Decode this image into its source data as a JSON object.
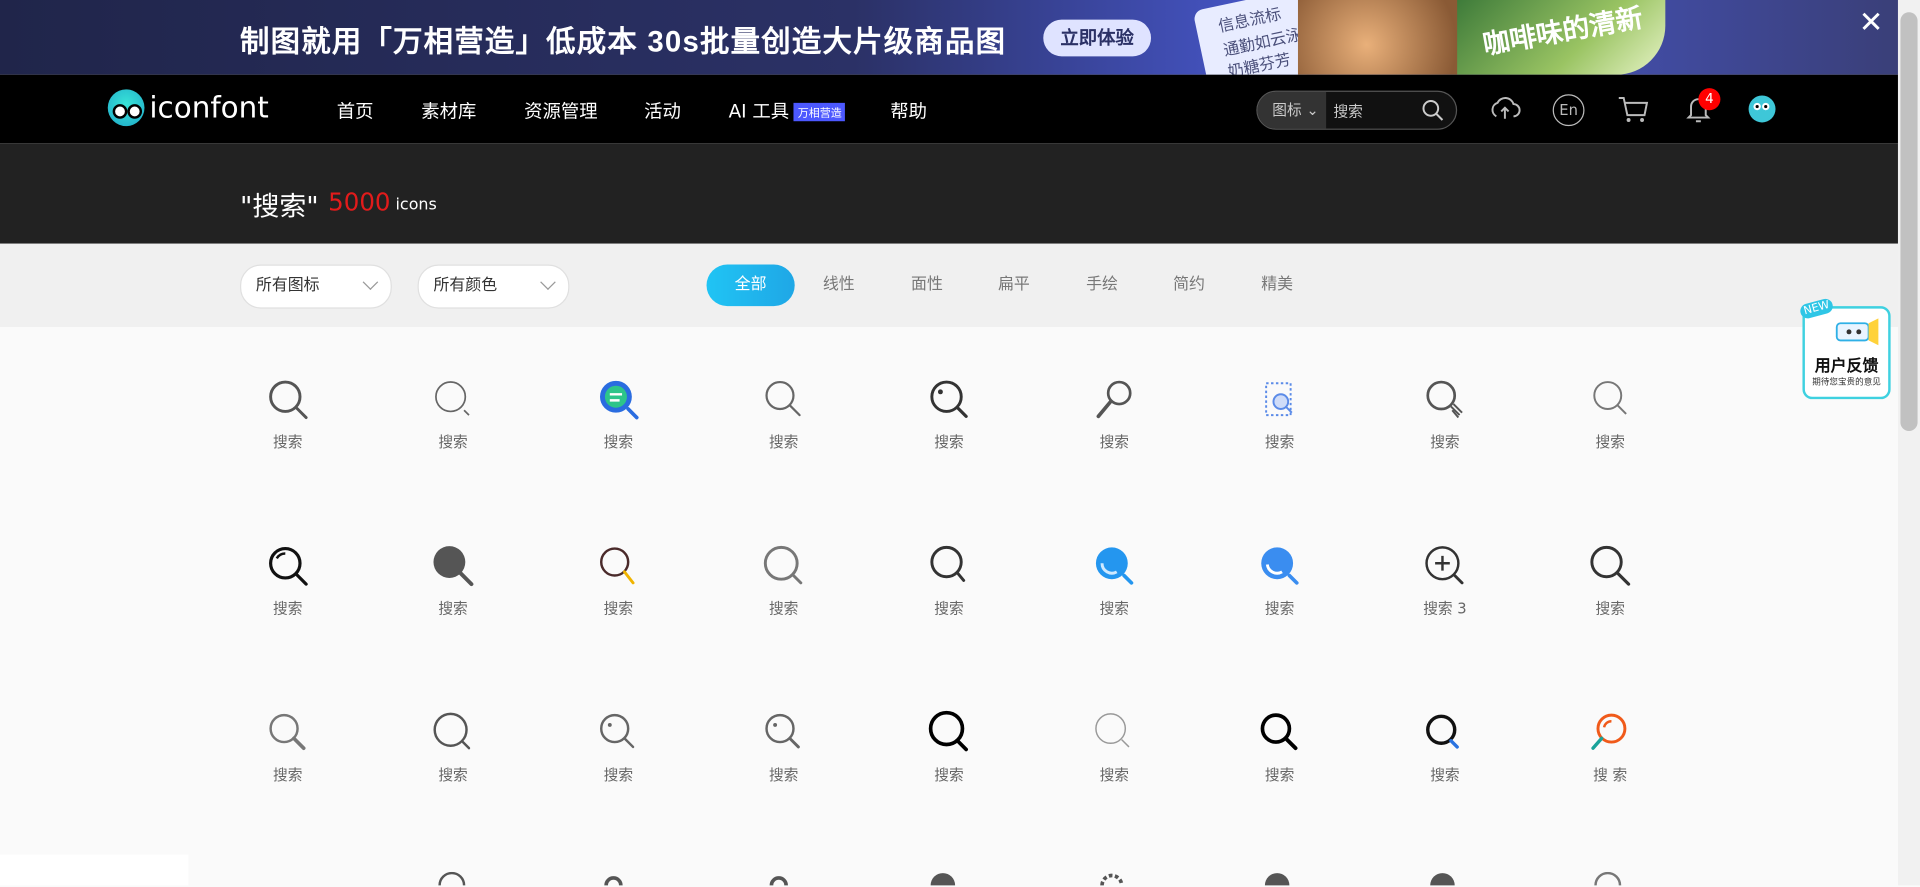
{
  "banner": {
    "text": "制图就用「万相营造」低成本 30s批量创造大片级商品图",
    "cta": "立即体验",
    "card_line1": "信息流标",
    "card_line2": "通勤如云泳",
    "card_line3": "奶糖芬芳",
    "leaf_text": "咖啡味的清新"
  },
  "nav": {
    "brand": "iconfont",
    "items": [
      "首页",
      "素材库",
      "资源管理",
      "活动",
      "AI 工具",
      "帮助"
    ],
    "ai_badge": "万相营造",
    "search_type": "图标",
    "search_placeholder": "搜索",
    "lang": "En",
    "notification_count": "4"
  },
  "title": {
    "query": "\"搜索\"",
    "count": "5000",
    "unit": "icons"
  },
  "filters": {
    "all_icons": "所有图标",
    "all_colors": "所有颜色",
    "tabs": [
      "全部",
      "线性",
      "面性",
      "扁平",
      "手绘",
      "简约",
      "精美"
    ]
  },
  "icons": [
    [
      "搜索",
      "搜索",
      "搜索",
      "搜索",
      "搜索",
      "搜索",
      "搜索",
      "搜索",
      "搜索"
    ],
    [
      "搜索",
      "搜索",
      "搜索",
      "搜索",
      "搜索",
      "搜索",
      "搜索",
      "搜索 3",
      "搜索"
    ],
    [
      "搜索",
      "搜索",
      "搜索",
      "搜索",
      "搜索",
      "搜索",
      "搜索",
      "搜索",
      "搜 索"
    ]
  ],
  "feedback": {
    "new": "NEW",
    "title": "用户反馈",
    "subtitle": "期待您宝贵的意见"
  },
  "colors": {
    "accent": "#1fb8f0",
    "count_red": "#e21b1b",
    "badge_red": "#ff0000"
  }
}
